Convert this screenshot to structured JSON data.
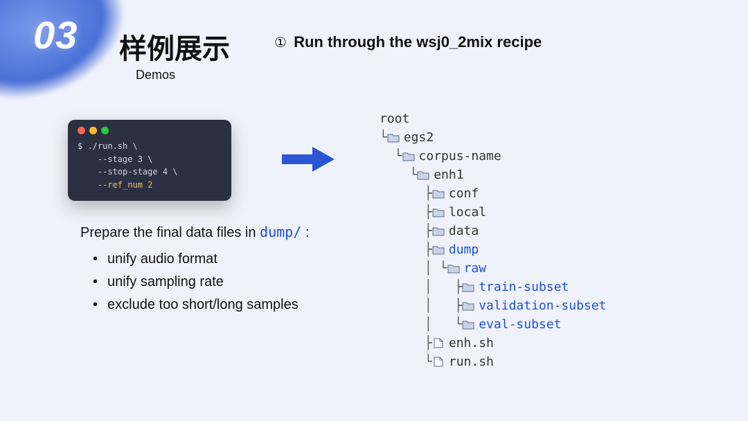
{
  "slide_number": "03",
  "title_main": "样例展示",
  "title_sub": "Demos",
  "subtitle_num": "①",
  "subtitle_text": "Run through the wsj0_2mix recipe",
  "terminal": {
    "prompt": "$ ",
    "cmd_l1": "./run.sh \\",
    "cmd_l2": "--stage 3 \\",
    "cmd_l3": "--stop-stage 4 \\",
    "cmd_l4": "--ref_num 2"
  },
  "caption_prefix": "Prepare the final data files in ",
  "caption_path": "dump/",
  "caption_suffix": " :",
  "bullets": [
    "unify audio format",
    "unify sampling rate",
    "exclude too short/long samples"
  ],
  "tree": {
    "root": "root",
    "egs2": "egs2",
    "corpus": "corpus-name",
    "enh1": "enh1",
    "conf": "conf",
    "local": "local",
    "data": "data",
    "dump": "dump",
    "raw": "raw",
    "train": "train-subset",
    "val": "validation-subset",
    "eval": "eval-subset",
    "enhsh": "enh.sh",
    "runsh": "run.sh"
  }
}
